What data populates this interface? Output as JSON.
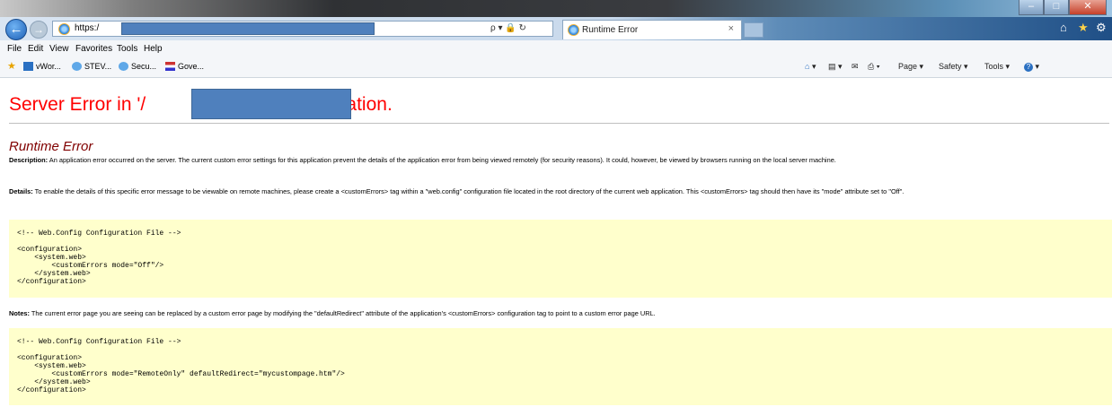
{
  "browser": {
    "address_prefix": "https:/",
    "tab_title": "Runtime Error",
    "tab_close": "×",
    "search_glyph": "ρ ▾ 🔒 ↻",
    "window_buttons": [
      "–",
      "□",
      "✕"
    ]
  },
  "menu": [
    "File",
    "Edit",
    "View",
    "Favorites",
    "Tools",
    "Help"
  ],
  "favorites": [
    "vWor...",
    "STEV...",
    "Secu...",
    "Gove..."
  ],
  "command_bar": [
    "▾",
    "▾",
    "▾",
    "Page ▾",
    "Safety ▾",
    "Tools ▾",
    "▾"
  ],
  "page": {
    "heading_start": "Server Error in '/",
    "heading_end": "Application.",
    "subheading": "Runtime Error",
    "description_label": "Description:",
    "description_text": " An application error occurred on the server. The current custom error settings for this application prevent the details of the application error from being viewed remotely (for security reasons). It could, however, be viewed by browsers running on the local server machine.",
    "details_label": "Details:",
    "details_text": " To enable the details of this specific error message to be viewable on remote machines, please create a <customErrors> tag within a \"web.config\" configuration file located in the root directory of the current web application. This <customErrors> tag should then have its \"mode\" attribute set to \"Off\".",
    "code1": "<!-- Web.Config Configuration File -->\n\n<configuration>\n    <system.web>\n        <customErrors mode=\"Off\"/>\n    </system.web>\n</configuration>",
    "notes_label": "Notes:",
    "notes_text": " The current error page you are seeing can be replaced by a custom error page by modifying the \"defaultRedirect\" attribute of the application's <customErrors> configuration tag to point to a custom error page URL.",
    "code2": "<!-- Web.Config Configuration File -->\n\n<configuration>\n    <system.web>\n        <customErrors mode=\"RemoteOnly\" defaultRedirect=\"mycustompage.htm\"/>\n    </system.web>\n</configuration>"
  }
}
